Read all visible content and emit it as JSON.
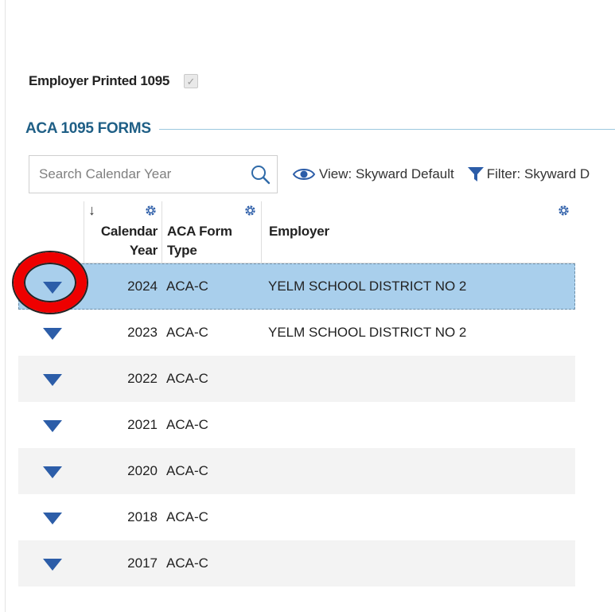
{
  "employer_printed": {
    "label": "Employer Printed 1095",
    "checked": true
  },
  "section": {
    "title": "ACA 1095 FORMS"
  },
  "toolbar": {
    "search_placeholder": "Search Calendar Year",
    "view_label": "View: Skyward Default",
    "filter_label": "Filter: Skyward D"
  },
  "grid": {
    "columns": {
      "year_line1": "Calendar",
      "year_line2": "Year",
      "type_line1": "ACA Form",
      "type_line2": "Type",
      "employer": "Employer"
    },
    "rows": [
      {
        "year": "2024",
        "type": "ACA-C",
        "employer": "YELM SCHOOL DISTRICT NO 2",
        "selected": true
      },
      {
        "year": "2023",
        "type": "ACA-C",
        "employer": "YELM SCHOOL DISTRICT NO 2"
      },
      {
        "year": "2022",
        "type": "ACA-C",
        "employer": ""
      },
      {
        "year": "2021",
        "type": "ACA-C",
        "employer": ""
      },
      {
        "year": "2020",
        "type": "ACA-C",
        "employer": ""
      },
      {
        "year": "2018",
        "type": "ACA-C",
        "employer": ""
      },
      {
        "year": "2017",
        "type": "ACA-C",
        "employer": ""
      }
    ]
  },
  "colors": {
    "accent": "#1f5f86",
    "selected_row": "#a9cfec",
    "expand_icon": "#2c5da8",
    "highlight_ring": "#ee0000"
  }
}
